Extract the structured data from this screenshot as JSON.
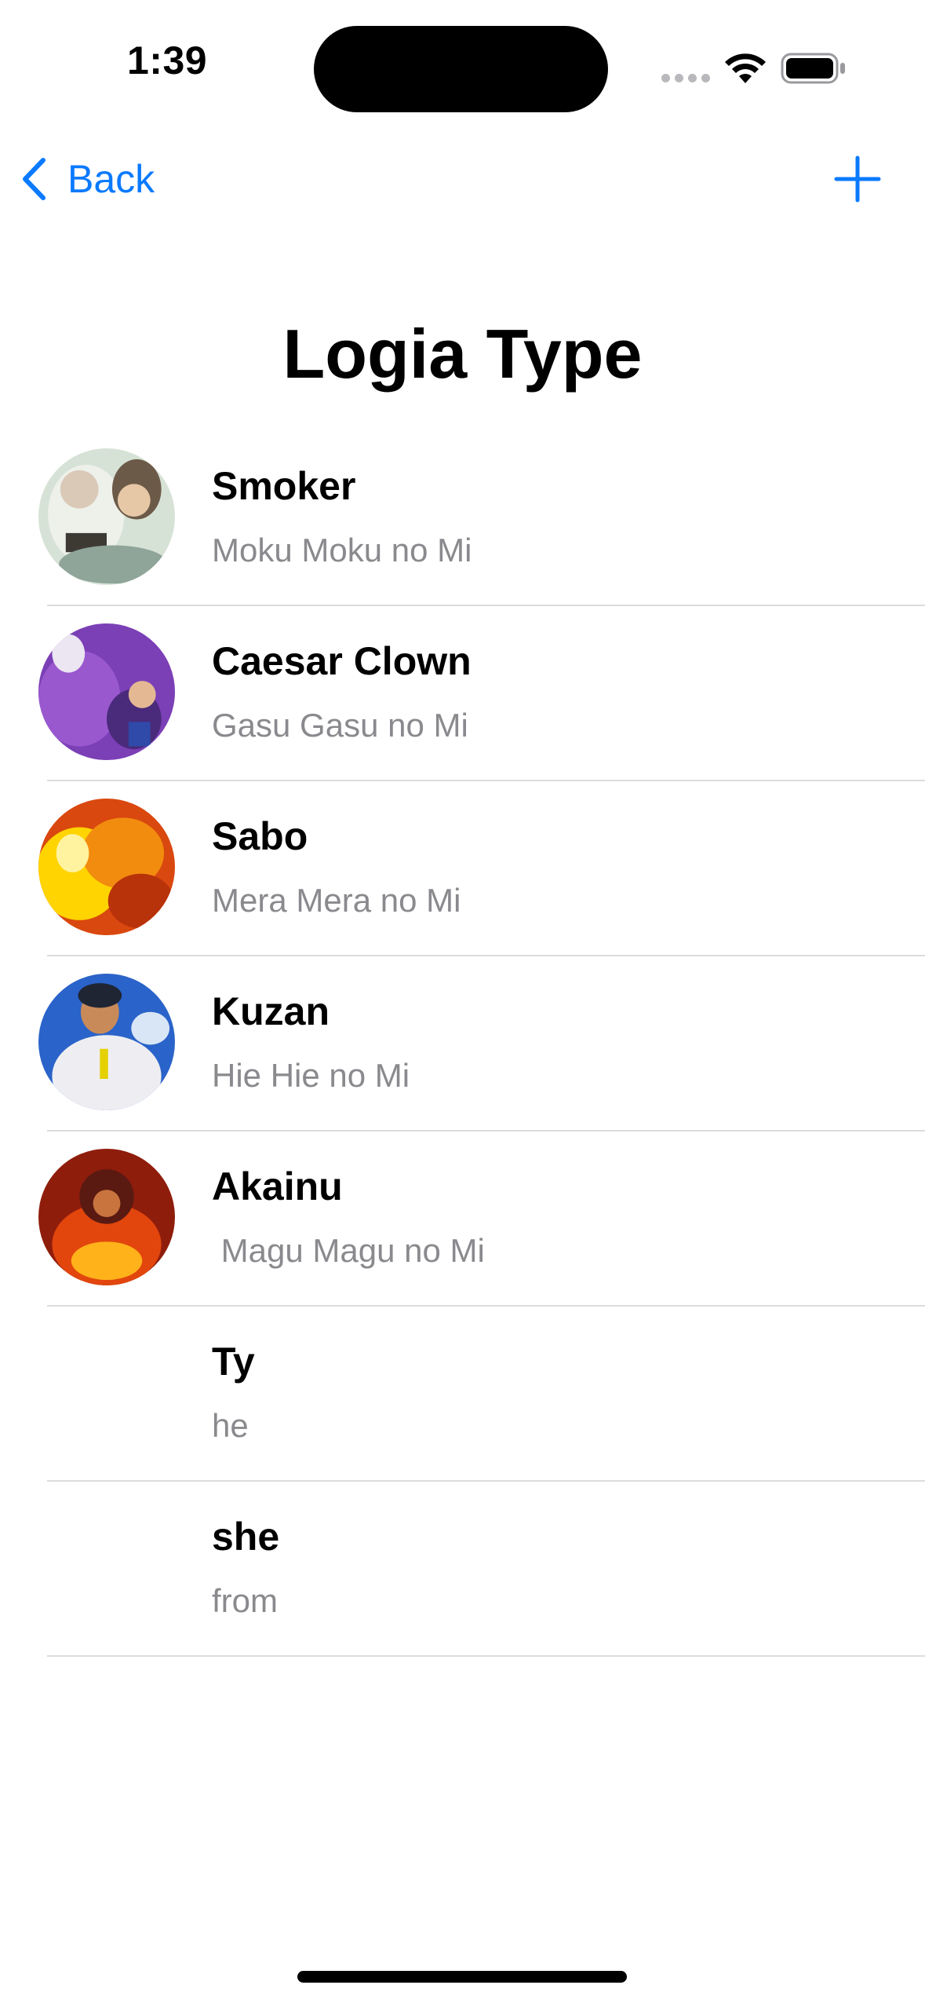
{
  "status_bar": {
    "time": "1:39",
    "icons": [
      "signal-dots-icon",
      "wifi-icon",
      "battery-icon"
    ]
  },
  "nav": {
    "back_label": "Back",
    "back_icon": "chevron-left-icon",
    "add_icon": "plus-icon",
    "accent_color": "#0a7aff"
  },
  "page": {
    "title": "Logia Type"
  },
  "items": [
    {
      "name": "Smoker",
      "fruit": "Moku Moku no Mi",
      "has_image": true
    },
    {
      "name": "Caesar Clown",
      "fruit": "Gasu Gasu no Mi",
      "has_image": true
    },
    {
      "name": "Sabo",
      "fruit": "Mera Mera no Mi",
      "has_image": true
    },
    {
      "name": "Kuzan",
      "fruit": "Hie Hie no Mi",
      "has_image": true
    },
    {
      "name": "Akainu",
      "fruit": " Magu Magu no Mi",
      "has_image": true
    },
    {
      "name": "Ty",
      "fruit": "he",
      "has_image": false
    },
    {
      "name": "she",
      "fruit": "from",
      "has_image": false
    }
  ]
}
